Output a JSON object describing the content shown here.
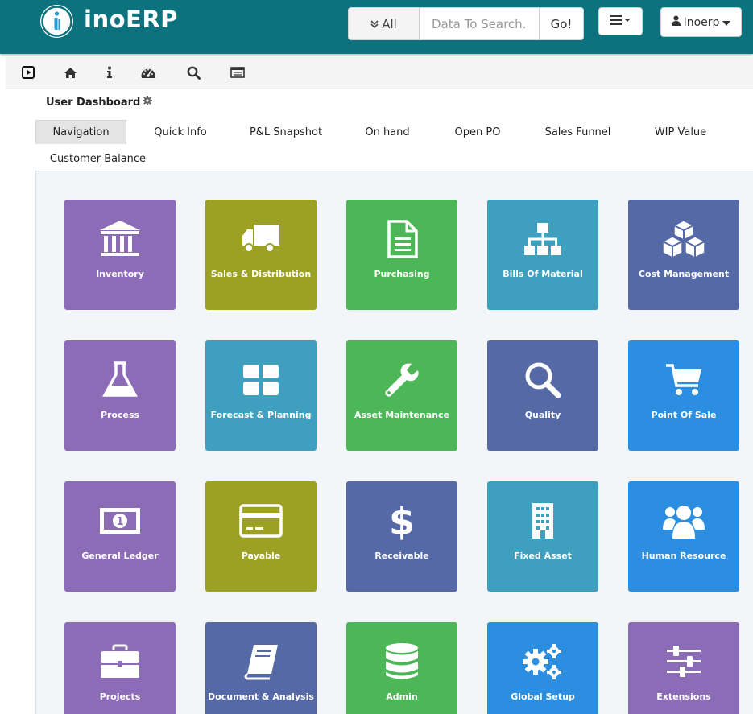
{
  "app": {
    "logo_text": "inoERP"
  },
  "search": {
    "scope_label": "All",
    "placeholder": "Data To Search...",
    "go_label": "Go!"
  },
  "user_menu": {
    "label": "Inoerp"
  },
  "dashboard": {
    "title": "User Dashboard"
  },
  "tabs": [
    {
      "label": "Navigation",
      "active": true
    },
    {
      "label": "Quick Info"
    },
    {
      "label": "P&L Snapshot"
    },
    {
      "label": "On hand"
    },
    {
      "label": "Open PO"
    },
    {
      "label": "Sales Funnel"
    },
    {
      "label": "WIP Value"
    },
    {
      "label": "Customer Balance"
    }
  ],
  "toolbar_icons": [
    "play-icon",
    "home-icon",
    "info-icon",
    "dashboard-icon",
    "search-icon",
    "window-icon"
  ],
  "modules": [
    {
      "label": "Inventory",
      "icon": "bank-icon",
      "color": "#8c6bb7"
    },
    {
      "label": "Sales & Distribution",
      "icon": "truck-icon",
      "color": "#9ca025"
    },
    {
      "label": "Purchasing",
      "icon": "document-icon",
      "color": "#4db657"
    },
    {
      "label": "Bills Of Material",
      "icon": "sitemap-icon",
      "color": "#3ea0be"
    },
    {
      "label": "Cost Management",
      "icon": "cubes-icon",
      "color": "#5569a6"
    },
    {
      "label": "Process",
      "icon": "flask-icon",
      "color": "#8c6bb7"
    },
    {
      "label": "Forecast & Planning",
      "icon": "grid-icon",
      "color": "#3ea0be"
    },
    {
      "label": "Asset Maintenance",
      "icon": "wrench-icon",
      "color": "#4db657"
    },
    {
      "label": "Quality",
      "icon": "magnifier-icon",
      "color": "#5569a6"
    },
    {
      "label": "Point Of Sale",
      "icon": "cart-icon",
      "color": "#2b8ee0"
    },
    {
      "label": "General Ledger",
      "icon": "money-icon",
      "color": "#8c6bb7"
    },
    {
      "label": "Payable",
      "icon": "credit-card-icon",
      "color": "#9ca025"
    },
    {
      "label": "Receivable",
      "icon": "dollar-icon",
      "color": "#5569a6"
    },
    {
      "label": "Fixed Asset",
      "icon": "building-icon",
      "color": "#3ea0be"
    },
    {
      "label": "Human Resource",
      "icon": "users-icon",
      "color": "#2b8ee0"
    },
    {
      "label": "Projects",
      "icon": "briefcase-icon",
      "color": "#8c6bb7"
    },
    {
      "label": "Document & Analysis",
      "icon": "book-icon",
      "color": "#5569a6"
    },
    {
      "label": "Admin",
      "icon": "database-icon",
      "color": "#4db657"
    },
    {
      "label": "Global Setup",
      "icon": "gears-icon",
      "color": "#2b8ee0"
    },
    {
      "label": "Extensions",
      "icon": "sliders-icon",
      "color": "#8c6bb7"
    }
  ]
}
